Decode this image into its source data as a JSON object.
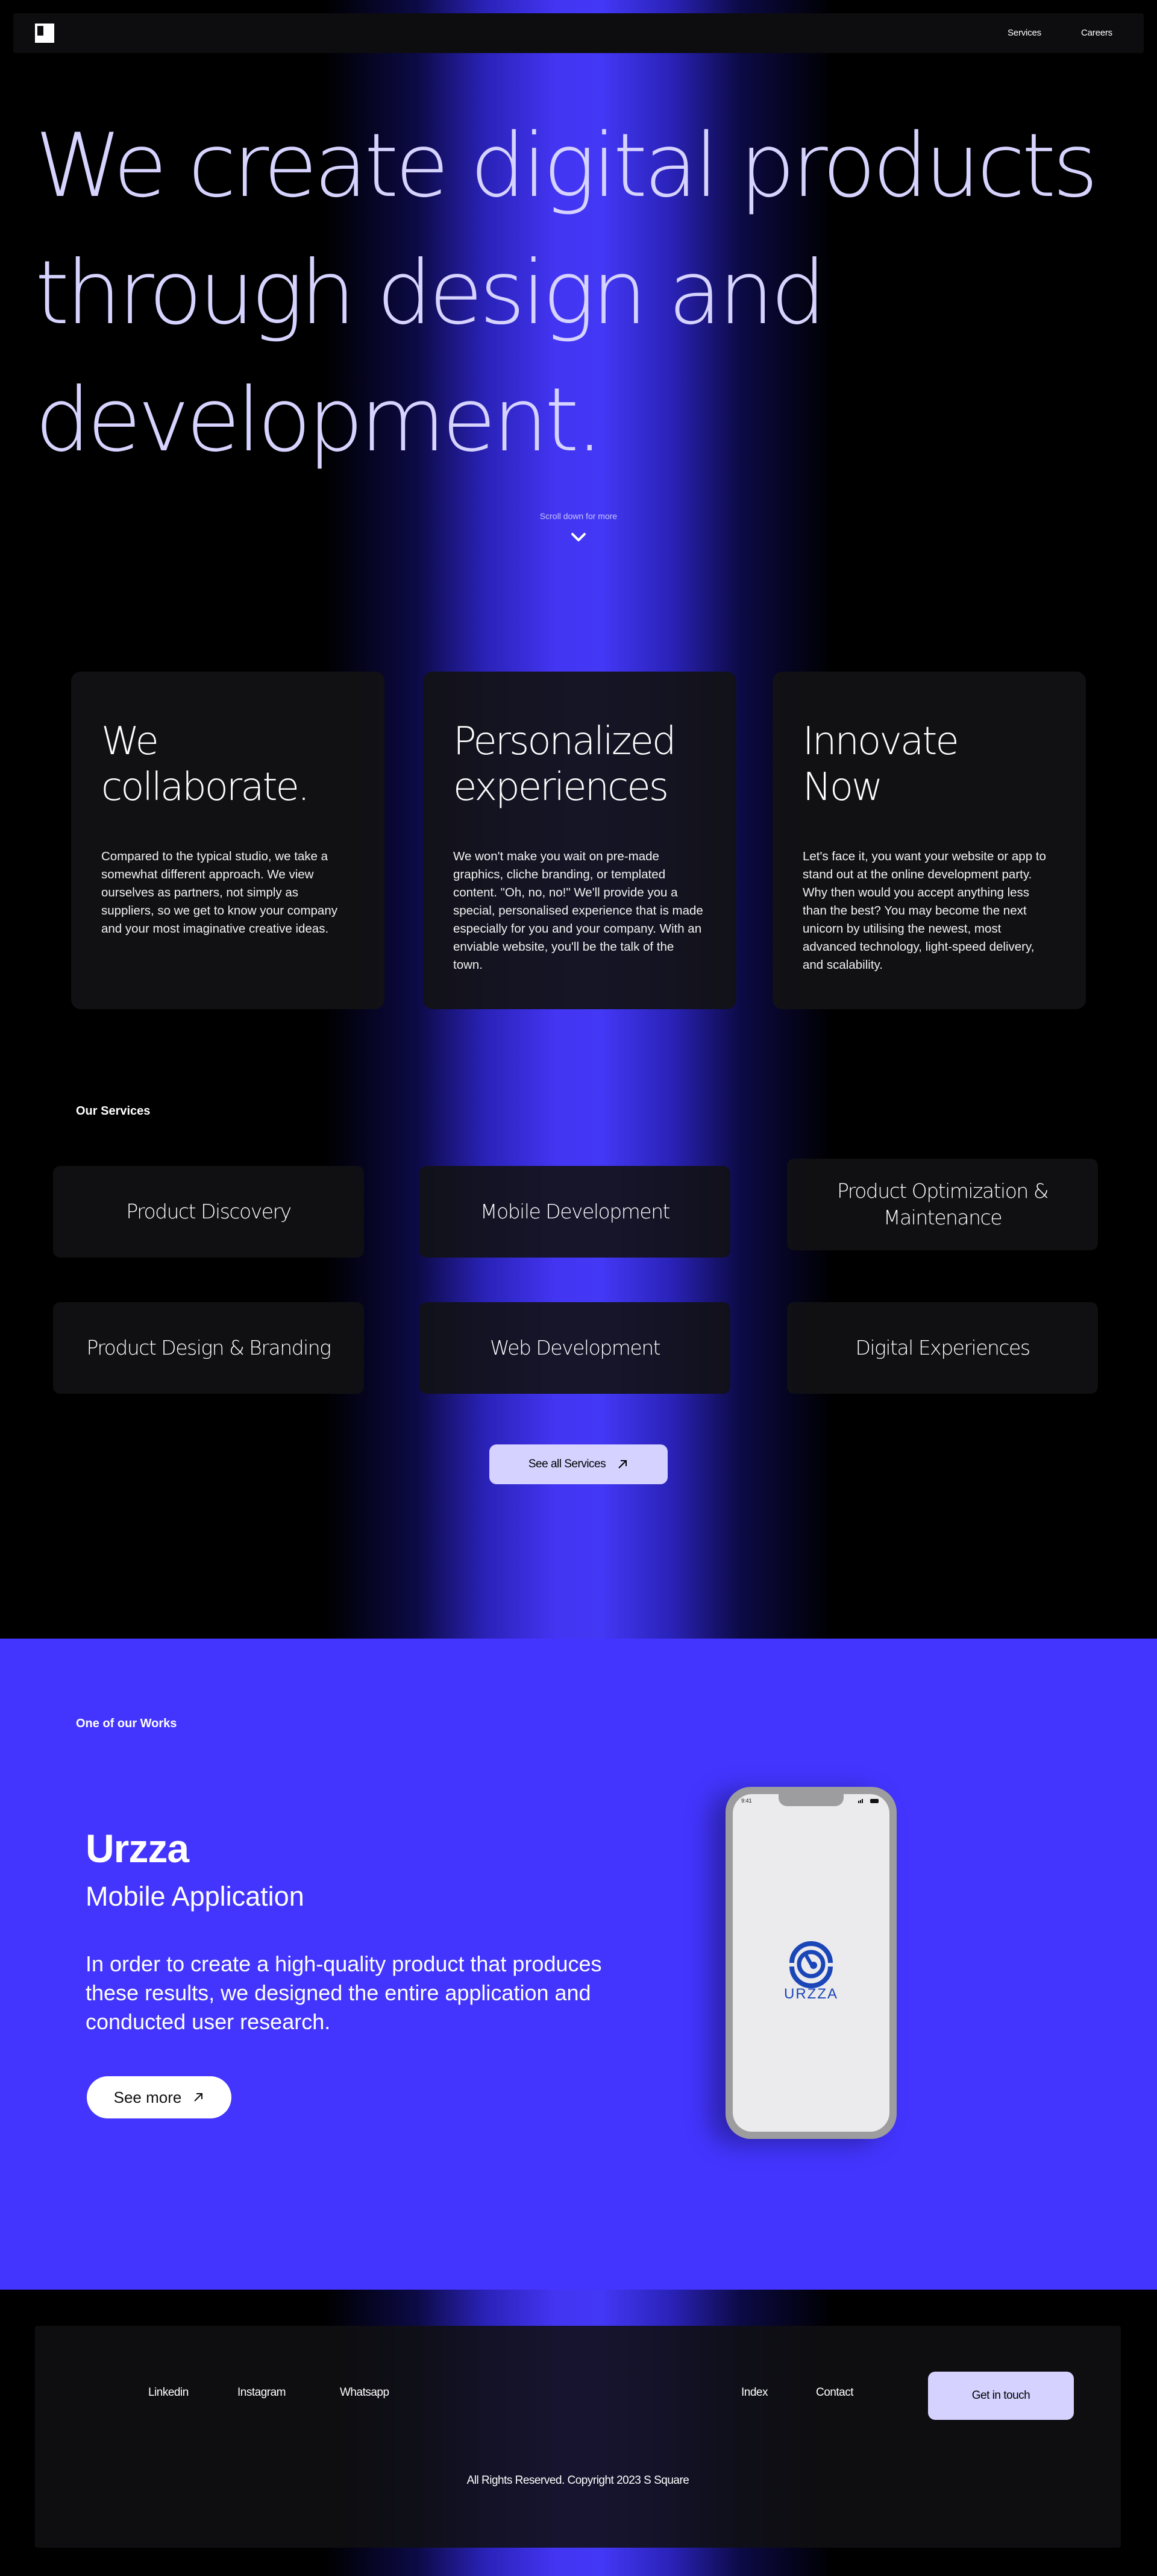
{
  "nav": {
    "links": [
      "Services",
      "Careers"
    ]
  },
  "hero": {
    "title_lines": [
      "We create digital products",
      "through design and",
      "development."
    ],
    "scroll_hint": "Scroll down for more"
  },
  "features": [
    {
      "title": "We collaborate.",
      "body": "Compared to the typical studio, we take a somewhat different approach. We view ourselves as partners, not simply as suppliers, so we get to know your company and your most imaginative creative ideas."
    },
    {
      "title": "Personalized experiences",
      "body": "We won't make you wait on pre-made graphics, cliche branding, or templated content. \"Oh, no, no!\" We'll provide you a special, personalised experience that is made especially for you and your company. With an enviable website, you'll be the talk of the town."
    },
    {
      "title": "Innovate Now",
      "body": "Let's face it, you want your website or app to stand out at the online development party. Why then would you accept anything less than the best? You may become the next unicorn by utilising the newest, most advanced technology, light-speed delivery, and scalability."
    }
  ],
  "services": {
    "label": "Our Services",
    "items": [
      "Product Discovery",
      "Mobile Development",
      "Product Optimization & Maintenance",
      "Product Design & Branding",
      "Web Development",
      "Digital Experiences"
    ],
    "see_all_label": "See all Services"
  },
  "work": {
    "label": "One of our Works",
    "title": "Urzza",
    "subtitle": "Mobile Application",
    "description": "In order to create a high-quality product that produces these results, we designed the entire application and conducted user research.",
    "see_more_label": "See more",
    "phone_time": "9:41",
    "app_name": "URZZA"
  },
  "footer": {
    "social_links": [
      "Linkedin",
      "Instagram",
      "Whatsapp"
    ],
    "page_links": [
      "Index",
      "Contact"
    ],
    "cta_label": "Get in touch",
    "copyright": "All Rights Reserved. Copyright 2023 S Square"
  },
  "colors": {
    "accent": "#4335fe",
    "accent_light": "#d5d2ff",
    "background": "#000000",
    "card": "#121214"
  }
}
